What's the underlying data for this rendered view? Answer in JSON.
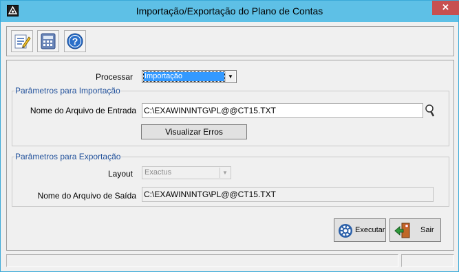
{
  "window": {
    "title": "Importação/Exportação do Plano de Contas",
    "close_glyph": "✕",
    "app_icon": "exactus-logo-icon"
  },
  "toolbar": {
    "items": [
      {
        "icon": "edit-notes-icon"
      },
      {
        "icon": "calculator-icon"
      },
      {
        "icon": "help-icon"
      }
    ]
  },
  "form": {
    "processar_label": "Processar",
    "processar_value": "Importação",
    "import_group": {
      "legend": "Parâmetros para Importação",
      "file_label": "Nome do Arquivo de Entrada",
      "file_value": "C:\\EXAWIN\\INTG\\PL@@CT15.TXT",
      "view_errors_label": "Visualizar Erros"
    },
    "export_group": {
      "legend": "Parâmetros para Exportação",
      "layout_label": "Layout",
      "layout_value": "Exactus",
      "file_label": "Nome do Arquivo de Saída",
      "file_value": "C:\\EXAWIN\\INTG\\PL@@CT15.TXT"
    }
  },
  "actions": {
    "execute_label": "Executar",
    "exit_label": "Sair"
  },
  "colors": {
    "titlebar": "#5ec0e6",
    "selection": "#3399ff",
    "legend": "#1f4f9a",
    "close": "#c75050"
  }
}
